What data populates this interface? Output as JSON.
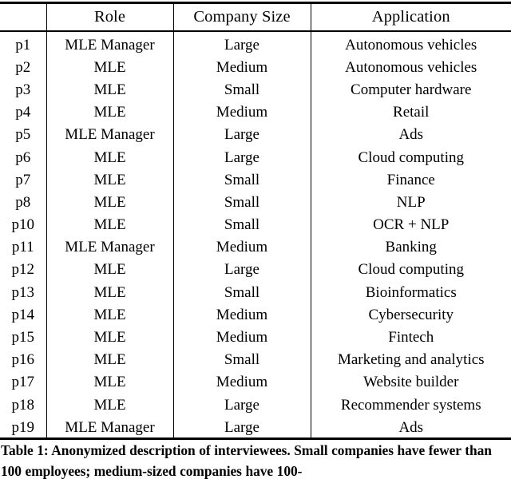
{
  "table": {
    "columns": [
      {
        "key": "id",
        "label": ""
      },
      {
        "key": "role",
        "label": "Role"
      },
      {
        "key": "companySize",
        "label": "Company Size"
      },
      {
        "key": "application",
        "label": "Application"
      }
    ],
    "rows": [
      {
        "id": "p1",
        "role": "MLE Manager",
        "companySize": "Large",
        "application": "Autonomous vehicles"
      },
      {
        "id": "p2",
        "role": "MLE",
        "companySize": "Medium",
        "application": "Autonomous vehicles"
      },
      {
        "id": "p3",
        "role": "MLE",
        "companySize": "Small",
        "application": "Computer hardware"
      },
      {
        "id": "p4",
        "role": "MLE",
        "companySize": "Medium",
        "application": "Retail"
      },
      {
        "id": "p5",
        "role": "MLE Manager",
        "companySize": "Large",
        "application": "Ads"
      },
      {
        "id": "p6",
        "role": "MLE",
        "companySize": "Large",
        "application": "Cloud computing"
      },
      {
        "id": "p7",
        "role": "MLE",
        "companySize": "Small",
        "application": "Finance"
      },
      {
        "id": "p8",
        "role": "MLE",
        "companySize": "Small",
        "application": "NLP"
      },
      {
        "id": "p10",
        "role": "MLE",
        "companySize": "Small",
        "application": "OCR + NLP"
      },
      {
        "id": "p11",
        "role": "MLE Manager",
        "companySize": "Medium",
        "application": "Banking"
      },
      {
        "id": "p12",
        "role": "MLE",
        "companySize": "Large",
        "application": "Cloud computing"
      },
      {
        "id": "p13",
        "role": "MLE",
        "companySize": "Small",
        "application": "Bioinformatics"
      },
      {
        "id": "p14",
        "role": "MLE",
        "companySize": "Medium",
        "application": "Cybersecurity"
      },
      {
        "id": "p15",
        "role": "MLE",
        "companySize": "Medium",
        "application": "Fintech"
      },
      {
        "id": "p16",
        "role": "MLE",
        "companySize": "Small",
        "application": "Marketing and analytics"
      },
      {
        "id": "p17",
        "role": "MLE",
        "companySize": "Medium",
        "application": "Website builder"
      },
      {
        "id": "p18",
        "role": "MLE",
        "companySize": "Large",
        "application": "Recommender systems"
      },
      {
        "id": "p19",
        "role": "MLE Manager",
        "companySize": "Large",
        "application": "Ads"
      }
    ]
  },
  "caption": {
    "text": "Table 1: Anonymized description of interviewees. Small companies have fewer than 100 employees; medium-sized companies have 100-"
  },
  "colors": {
    "text": "#000000",
    "background": "#ffffff",
    "rule": "#000000"
  }
}
